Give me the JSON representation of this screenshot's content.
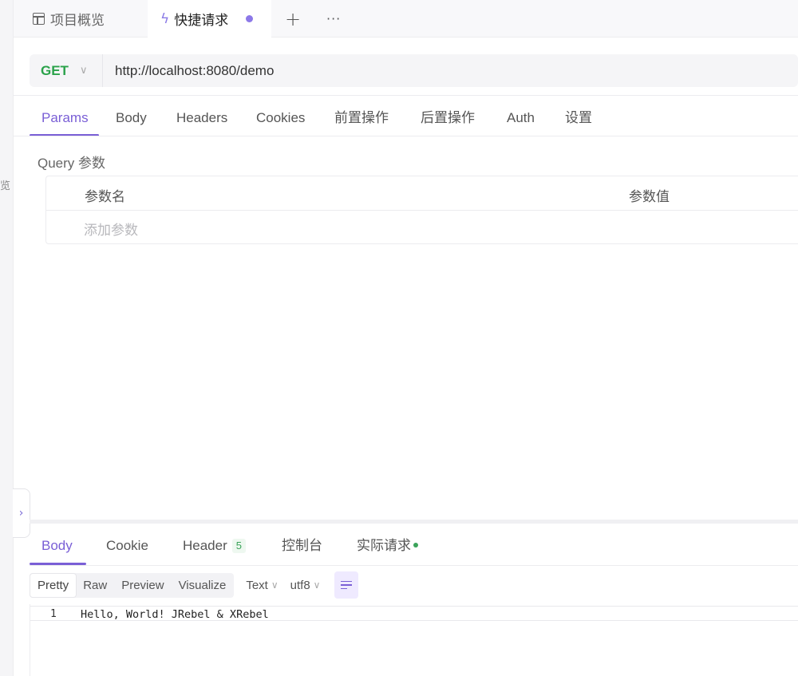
{
  "left_panel": {
    "partial_char": "览",
    "expand_icon": "chevron-right"
  },
  "tabs": [
    {
      "label": "项目概览",
      "icon": "layout-icon"
    },
    {
      "label": "快捷请求",
      "icon": "bolt-icon",
      "unsaved_dot": true
    }
  ],
  "tab_actions": {
    "add": "+",
    "more": "···"
  },
  "request": {
    "method": "GET",
    "url": "http://localhost:8080/demo"
  },
  "request_tabs": [
    "Params",
    "Body",
    "Headers",
    "Cookies",
    "前置操作",
    "后置操作",
    "Auth",
    "设置"
  ],
  "active_request_tab": "Params",
  "query": {
    "title": "Query 参数",
    "columns": {
      "name": "参数名",
      "value": "参数值"
    },
    "add_placeholder": "添加参数"
  },
  "response_tabs": {
    "body": "Body",
    "cookie": "Cookie",
    "header": "Header",
    "header_count": "5",
    "console": "控制台",
    "actual_request": "实际请求"
  },
  "active_response_tab": "Body",
  "format": {
    "views": [
      "Pretty",
      "Raw",
      "Preview",
      "Visualize"
    ],
    "active_view": "Pretty",
    "type": "Text",
    "encoding": "utf8"
  },
  "body_lines": [
    {
      "no": "1",
      "text": "Hello, World! JRebel & XRebel"
    }
  ],
  "colors": {
    "accent": "#7a5fd6",
    "method_get": "#2aa24a",
    "status_green": "#3ba35a"
  }
}
